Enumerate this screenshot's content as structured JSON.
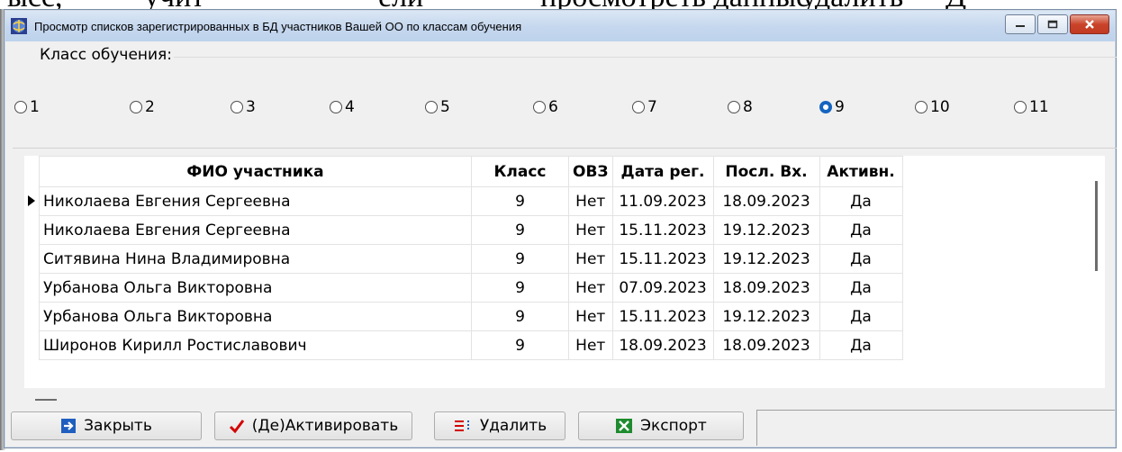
{
  "background_text": {
    "a": "ысс,",
    "b": "учит",
    "c": "ели",
    "d": "просмотреть данные",
    "e": "удалить",
    "f": "Д"
  },
  "window": {
    "title": "Просмотр списков зарегистрированных в БД участников Вашей ОО по классам обучения",
    "icon": "app-globe-icon"
  },
  "class_selector": {
    "label": "Класс обучения:",
    "options": [
      "1",
      "2",
      "3",
      "4",
      "5",
      "6",
      "7",
      "8",
      "9",
      "10",
      "11"
    ],
    "selected": "9"
  },
  "table": {
    "columns": [
      "ФИО участника",
      "Класс",
      "ОВЗ",
      "Дата рег.",
      "Посл. Вх.",
      "Активн."
    ],
    "rows": [
      [
        "Николаева Евгения Сергеевна",
        "9",
        "Нет",
        "11.09.2023",
        "18.09.2023",
        "Да"
      ],
      [
        "Николаева Евгения Сергеевна",
        "9",
        "Нет",
        "15.11.2023",
        "19.12.2023",
        "Да"
      ],
      [
        "Ситявина Нина Владимировна",
        "9",
        "Нет",
        "15.11.2023",
        "19.12.2023",
        "Да"
      ],
      [
        "Урбанова Ольга Викторовна",
        "9",
        "Нет",
        "07.09.2023",
        "18.09.2023",
        "Да"
      ],
      [
        "Урбанова Ольга Викторовна",
        "9",
        "Нет",
        "15.11.2023",
        "19.12.2023",
        "Да"
      ],
      [
        "Широнов Кирилл Ростиславович",
        "9",
        "Нет",
        "18.09.2023",
        "18.09.2023",
        "Да"
      ]
    ],
    "current_row": 0
  },
  "buttons": {
    "close": "Закрыть",
    "activate": "(Де)Активировать",
    "delete": "Удалить",
    "export": "Экспорт"
  },
  "colors": {
    "radio_checked": "#1565c0",
    "close_red": "#c23a22",
    "check_red": "#d40000",
    "export_green": "#1e8b2e"
  }
}
